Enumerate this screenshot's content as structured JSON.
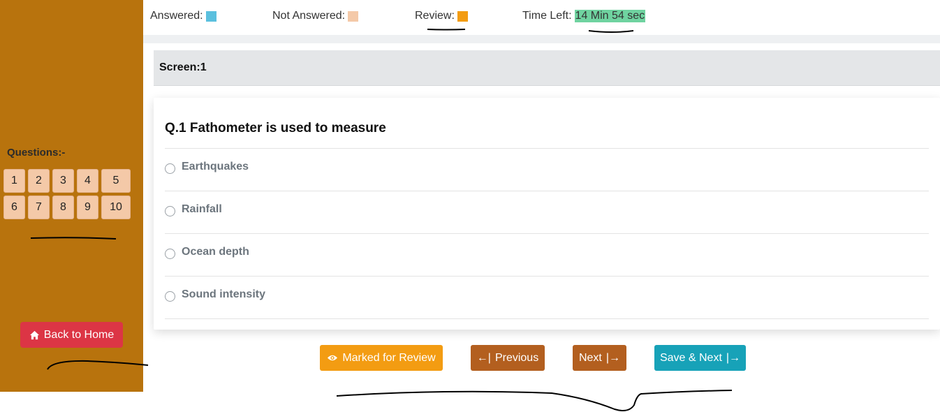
{
  "legend": {
    "answered": "Answered:",
    "not_answered": "Not Answered:",
    "review": "Review:",
    "time_left_label": "Time Left:",
    "time_left_value": "14 Min 54 sec",
    "colors": {
      "answered": "#5bc0de",
      "not_answered": "#f4c9a8",
      "review": "#f39c12",
      "time_bg": "#6fd3a0"
    }
  },
  "sidebar": {
    "heading": "Questions:-",
    "question_numbers": [
      "1",
      "2",
      "3",
      "4",
      "5",
      "6",
      "7",
      "8",
      "9",
      "10"
    ],
    "home_label": "Back to Home",
    "home_icon": "home-icon"
  },
  "screen": {
    "label": "Screen:1"
  },
  "question": {
    "text": "Q.1 Fathometer is used to measure",
    "options": [
      "Earthquakes",
      "Rainfall",
      "Ocean depth",
      "Sound intensity"
    ]
  },
  "actions": {
    "review": "Marked for Review",
    "review_icon": "eye-icon",
    "previous_arrow": "←|",
    "previous": "Previous",
    "next": "Next",
    "next_arrow": "|→",
    "save_next": "Save & Next",
    "save_next_arrow": "|→"
  }
}
